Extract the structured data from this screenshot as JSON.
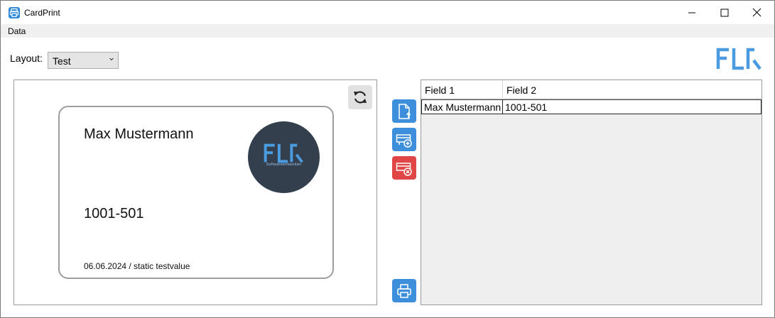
{
  "window": {
    "title": "CardPrint",
    "icon": "printer-icon",
    "controls": [
      "minimize-icon",
      "maximize-icon",
      "close-icon"
    ]
  },
  "menu": {
    "items": [
      {
        "label": "Data"
      }
    ]
  },
  "layout": {
    "label": "Layout:",
    "selected": "Test"
  },
  "logo": {
    "text": "FLR",
    "color": "#4a9be0"
  },
  "preview": {
    "refresh_icon": "refresh-icon",
    "card": {
      "name": "Max Mustermann",
      "number": "1001-501",
      "footer": "06.06.2024 / static testvalue",
      "logo_text": "FLR",
      "logo_subtitle": "Softwareentwickler",
      "logo_bg": "#333f4d"
    }
  },
  "actions": {
    "import_icon": "import-file-icon",
    "add_icon": "add-card-icon",
    "remove_icon": "remove-card-icon",
    "print_icon": "printer-icon",
    "accent": "#3d8fdb",
    "danger": "#e04646"
  },
  "grid": {
    "columns": [
      "Field 1",
      "Field 2"
    ],
    "rows": [
      [
        "Max Mustermann",
        "1001-501"
      ]
    ]
  }
}
